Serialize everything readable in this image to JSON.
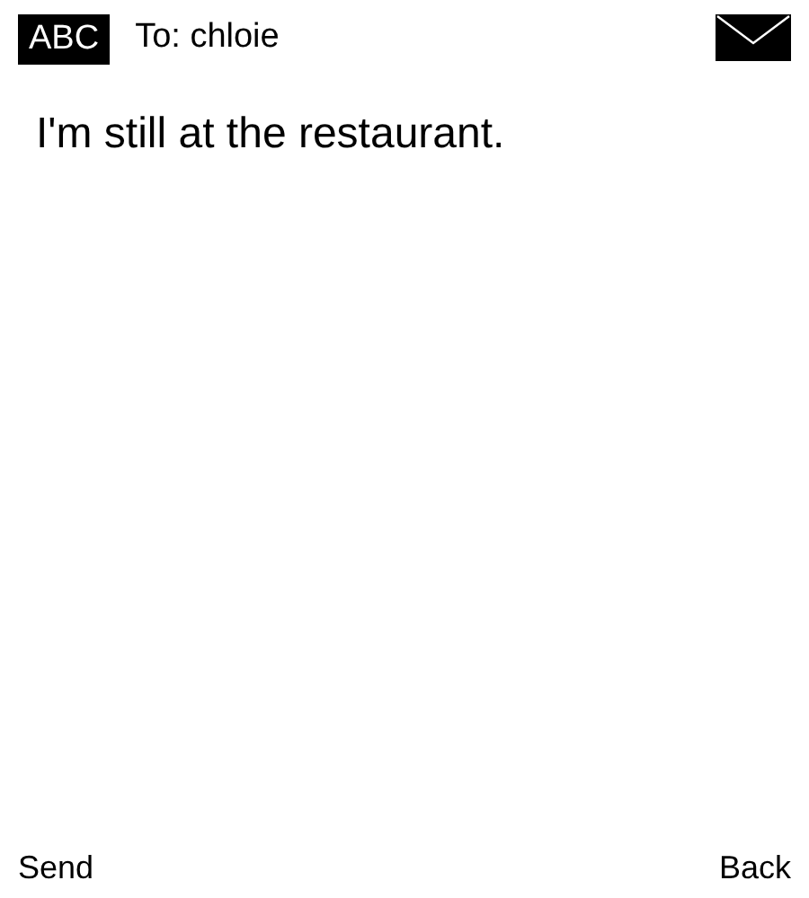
{
  "header": {
    "input_mode": "ABC",
    "recipient": "To: chloie"
  },
  "message": {
    "text": "I'm still at the restaurant."
  },
  "softkeys": {
    "left": "Send",
    "right": "Back"
  }
}
